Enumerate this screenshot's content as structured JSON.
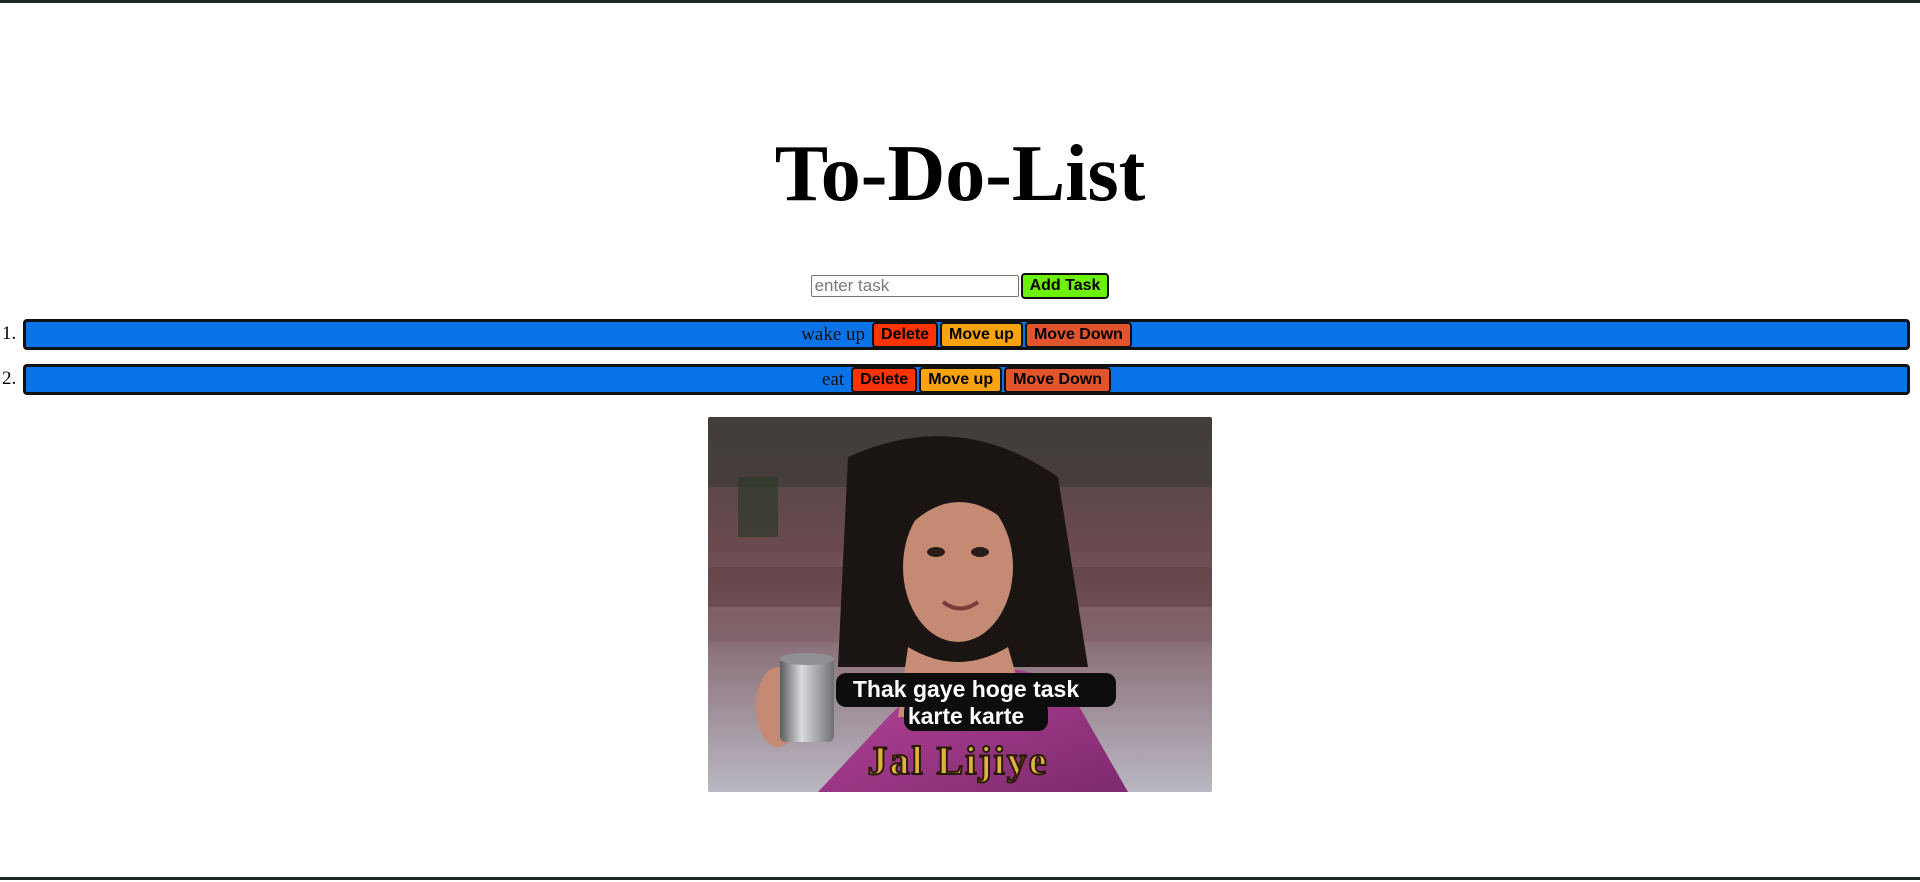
{
  "header": {
    "title": "To-Do-List"
  },
  "add_task": {
    "placeholder": "enter task",
    "value": "",
    "button_label": "Add Task"
  },
  "tasks": [
    {
      "number": "1.",
      "text": "wake up",
      "delete_label": "Delete",
      "move_up_label": "Move up",
      "move_down_label": "Move Down"
    },
    {
      "number": "2.",
      "text": "eat",
      "delete_label": "Delete",
      "move_up_label": "Move up",
      "move_down_label": "Move Down"
    }
  ],
  "meme": {
    "caption_line1": "Thak gaye hoge task",
    "caption_line2": "karte karte",
    "subtitle": "Jal Lijiye"
  },
  "colors": {
    "task_bar": "#0b73e8",
    "add_button": "#6df00a",
    "delete_button": "#ff3300",
    "move_up_button": "#f9a310",
    "move_down_button": "#e1542c"
  }
}
